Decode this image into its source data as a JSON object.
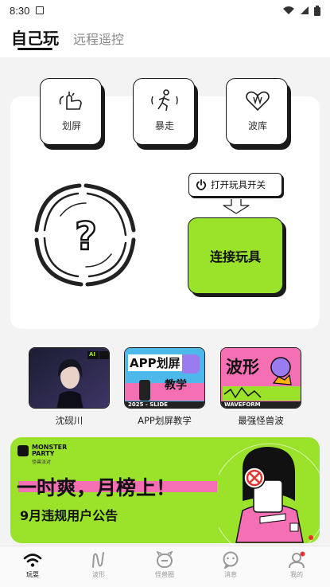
{
  "status_bar": {
    "time": "8:30"
  },
  "top_tabs": {
    "active": "自己玩",
    "inactive": "远程遥控"
  },
  "modes": [
    {
      "label": "划屏",
      "icon": "swipe-hand-icon"
    },
    {
      "label": "暴走",
      "icon": "running-person-icon"
    },
    {
      "label": "波库",
      "icon": "wave-heart-icon"
    }
  ],
  "tip": {
    "text": "打开玩具开关",
    "icon": "power-icon"
  },
  "toy_placeholder": {
    "symbol": "?"
  },
  "connect_button": {
    "label": "连接玩具"
  },
  "content_cards": [
    {
      "label": "沈砚川",
      "badge": "AI",
      "colors": [
        "#1b1d33",
        "#3e3566"
      ]
    },
    {
      "label": "APP划屏教学",
      "art_title_1": "APP划屏",
      "art_title_2": "教学",
      "art_footer": "2025 - SLIDE"
    },
    {
      "label": "最强怪兽波",
      "art_title": "波形",
      "art_footer": "WAVEFORM"
    }
  ],
  "banner": {
    "brand_line_1": "MONSTER",
    "brand_line_2": "PARTY",
    "brand_sub": "怪兽派对",
    "headline": "一时爽，月榜上！",
    "subline": "9月违规用户公告"
  },
  "bottom_nav": [
    {
      "label": "玩耍",
      "icon": "wifi-signal-icon",
      "active": true
    },
    {
      "label": "波形",
      "icon": "wave-icon",
      "active": false
    },
    {
      "label": "怪兽圈",
      "icon": "monster-face-icon",
      "active": false
    },
    {
      "label": "消息",
      "icon": "message-bubble-icon",
      "active": false
    },
    {
      "label": "我的",
      "icon": "profile-icon",
      "active": false
    }
  ],
  "colors": {
    "accent_green": "#9be22b",
    "accent_pink": "#f46fb4",
    "dark": "#1a1a1a"
  }
}
